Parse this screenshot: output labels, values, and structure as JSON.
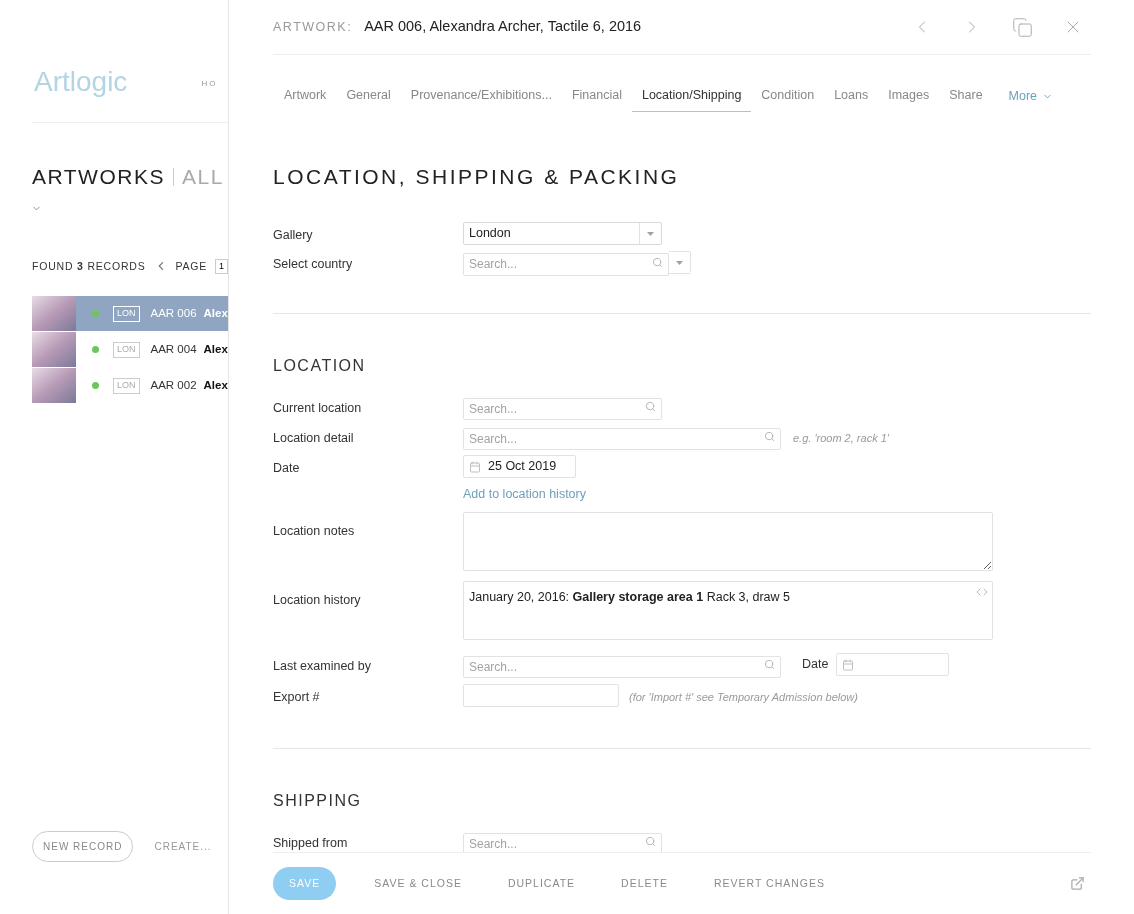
{
  "background": {
    "logo": "Artlogic",
    "nav_item": "HO",
    "heading": "ARTWORKS",
    "subheading": "ALL",
    "found": {
      "prefix": "FOUND",
      "count": "3",
      "suffix": "RECORDS"
    },
    "page_label": "PAGE",
    "page": "1",
    "records": [
      {
        "selected": true,
        "color": "#6cc75a",
        "location": "LON",
        "code": "AAR 006",
        "name": "Alex"
      },
      {
        "selected": false,
        "color": "#6cc75a",
        "location": "LON",
        "code": "AAR 004",
        "name": "Alex"
      },
      {
        "selected": false,
        "color": "#6cc75a",
        "location": "LON",
        "code": "AAR 002",
        "name": "Alex"
      }
    ],
    "buttons": [
      {
        "kind": "outline",
        "label": "NEW RECORD"
      },
      {
        "kind": "text",
        "label": "CREATE..."
      }
    ]
  },
  "drawer": {
    "title_label": "ARTWORK:",
    "title": "AAR 006, Alexandra Archer, Tactile 6, 2016",
    "tabs": [
      {
        "label": "Artwork",
        "selected": false
      },
      {
        "label": "General",
        "selected": false
      },
      {
        "label": "Provenance/Exhibitions...",
        "selected": false
      },
      {
        "label": "Financial",
        "selected": false
      },
      {
        "label": "Location/Shipping",
        "selected": true
      },
      {
        "label": "Condition",
        "selected": false
      },
      {
        "label": "Loans",
        "selected": false
      },
      {
        "label": "Images",
        "selected": false
      },
      {
        "label": "Share",
        "selected": false
      }
    ],
    "more": "More",
    "heading": "LOCATION, SHIPPING & PACKING",
    "top_fields": [
      {
        "kind": "select",
        "label": "Gallery",
        "value": "London"
      },
      {
        "kind": "search_select",
        "label": "Select country",
        "placeholder": "Search..."
      }
    ],
    "sections": [
      {
        "heading": "LOCATION",
        "fields": [
          {
            "kind": "search",
            "label": "Current location",
            "placeholder": "Search..."
          },
          {
            "kind": "search",
            "label": "Location detail",
            "placeholder": "Search...",
            "hint": "e.g. 'room 2, rack 1'"
          },
          {
            "kind": "date",
            "label": "Date",
            "value": "25 Oct 2019"
          },
          {
            "kind": "link",
            "text": "Add to location history"
          },
          {
            "kind": "textarea",
            "label": "Location notes"
          },
          {
            "kind": "richtext",
            "label": "Location history",
            "value": "January 20, 2016: **Gallery storage area 1** Rack 3, draw 5"
          },
          {
            "kind": "search_date",
            "label": "Last examined by",
            "placeholder": "Search...",
            "date_label": "Date"
          },
          {
            "kind": "text",
            "label": "Export #",
            "hint": "(for 'Import #' see Temporary Admission below)"
          }
        ]
      },
      {
        "heading": "SHIPPING",
        "fields": [
          {
            "kind": "search",
            "label": "Shipped from",
            "placeholder": "Search..."
          }
        ]
      }
    ],
    "footer": [
      {
        "kind": "primary",
        "label": "SAVE"
      },
      {
        "kind": "plain",
        "label": "SAVE & CLOSE"
      },
      {
        "kind": "plain",
        "label": "DUPLICATE"
      },
      {
        "kind": "plain",
        "label": "DELETE"
      },
      {
        "kind": "plain",
        "label": "REVERT CHANGES"
      }
    ]
  }
}
